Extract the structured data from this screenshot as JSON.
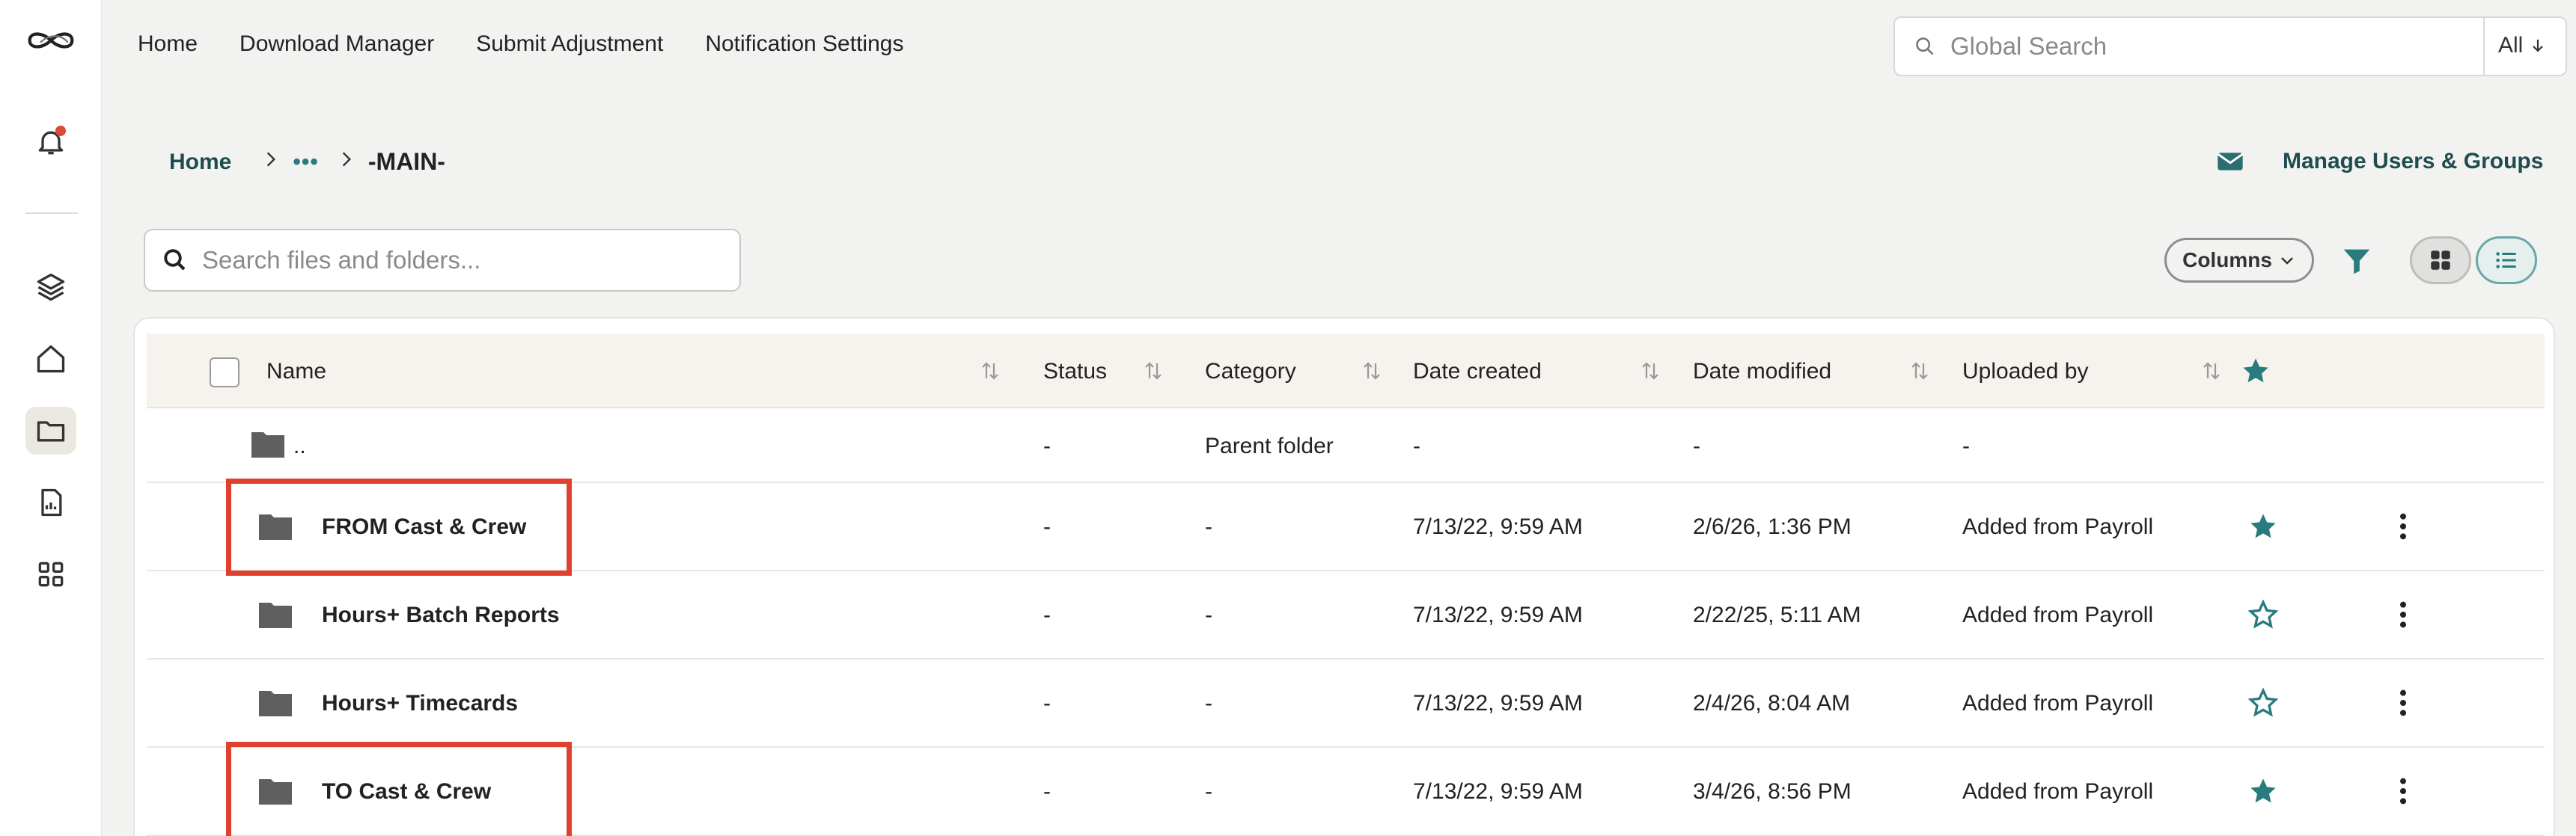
{
  "colors": {
    "accent": "#2a7b7d",
    "highlight": "#e0412f",
    "notification_dot": "#d94a3a",
    "header_bg": "#f6f3ee"
  },
  "topnav": {
    "items": [
      "Home",
      "Download Manager",
      "Submit Adjustment",
      "Notification Settings"
    ]
  },
  "global_search": {
    "placeholder": "Global Search",
    "scope": "All"
  },
  "sidebar": {
    "items": [
      {
        "icon": "logo-icon"
      },
      {
        "icon": "bell-icon"
      },
      {
        "icon": "layers-icon"
      },
      {
        "icon": "home-icon"
      },
      {
        "icon": "folder-icon",
        "active": true
      },
      {
        "icon": "report-icon"
      },
      {
        "icon": "apps-grid-icon"
      }
    ]
  },
  "breadcrumb": {
    "home": "Home",
    "ellipsis": "•••",
    "current": "-MAIN-"
  },
  "manage": {
    "label": "Manage Users & Groups",
    "icon": "envelope-icon"
  },
  "file_search": {
    "placeholder": "Search files and folders..."
  },
  "toolbar": {
    "columns_label": "Columns"
  },
  "table": {
    "columns": [
      "Name",
      "Status",
      "Category",
      "Date created",
      "Date modified",
      "Uploaded by"
    ],
    "parent_row": {
      "name": "..",
      "status": "-",
      "category": "Parent folder",
      "date_created": "-",
      "date_modified": "-",
      "uploaded_by": "-"
    },
    "rows": [
      {
        "name": "FROM Cast & Crew",
        "status": "-",
        "category": "-",
        "date_created": "7/13/22, 9:59 AM",
        "date_modified": "2/6/26, 1:36 PM",
        "uploaded_by": "Added from Payroll",
        "starred": true,
        "highlighted": true
      },
      {
        "name": "Hours+ Batch Reports",
        "status": "-",
        "category": "-",
        "date_created": "7/13/22, 9:59 AM",
        "date_modified": "2/22/25, 5:11 AM",
        "uploaded_by": "Added from Payroll",
        "starred": false,
        "highlighted": false
      },
      {
        "name": "Hours+ Timecards",
        "status": "-",
        "category": "-",
        "date_created": "7/13/22, 9:59 AM",
        "date_modified": "2/4/26, 8:04 AM",
        "uploaded_by": "Added from Payroll",
        "starred": false,
        "highlighted": false
      },
      {
        "name": "TO Cast & Crew",
        "status": "-",
        "category": "-",
        "date_created": "7/13/22, 9:59 AM",
        "date_modified": "3/4/26, 8:56 PM",
        "uploaded_by": "Added from Payroll",
        "starred": true,
        "highlighted": true
      }
    ]
  }
}
